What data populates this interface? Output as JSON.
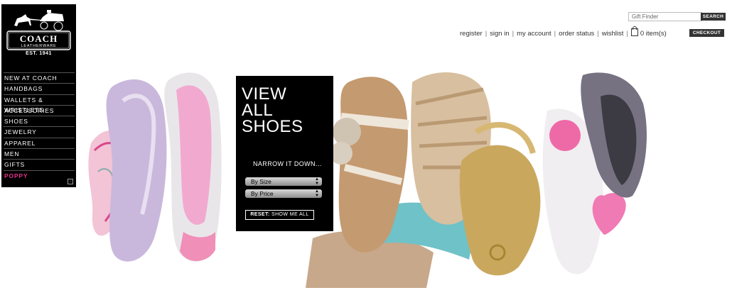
{
  "brand": {
    "name": "COACH",
    "sub": "LEATHERWARE",
    "est": "EST. 1941"
  },
  "nav": {
    "items": [
      {
        "label": "NEW AT COACH"
      },
      {
        "label": "HANDBAGS"
      },
      {
        "label": "WALLETS & WRISTLETS"
      },
      {
        "label": "ACCESSORIES"
      },
      {
        "label": "SHOES"
      },
      {
        "label": "JEWELRY"
      },
      {
        "label": "APPAREL"
      },
      {
        "label": "MEN"
      },
      {
        "label": "GIFTS"
      },
      {
        "label": "POPPY"
      }
    ],
    "collapse_symbol": "−"
  },
  "header": {
    "gift_finder_placeholder": "Gift Finder",
    "search_label": "SEARCH",
    "links": [
      "register",
      "sign in",
      "my account",
      "order status",
      "wishlist"
    ],
    "bag_count": "0 item(s)",
    "checkout_label": "CHECKOUT"
  },
  "panel": {
    "title_line1": "VIEW",
    "title_line2": "ALL",
    "title_line3": "SHOES",
    "narrow": "NARROW IT DOWN...",
    "by_size": "By Size",
    "by_price": "By Price",
    "reset_prefix": "RESET:",
    "reset_label": "SHOW ME ALL"
  },
  "colors": {
    "poppy": "#e0308a",
    "nav_bg": "#000000",
    "button_bg": "#333333"
  }
}
